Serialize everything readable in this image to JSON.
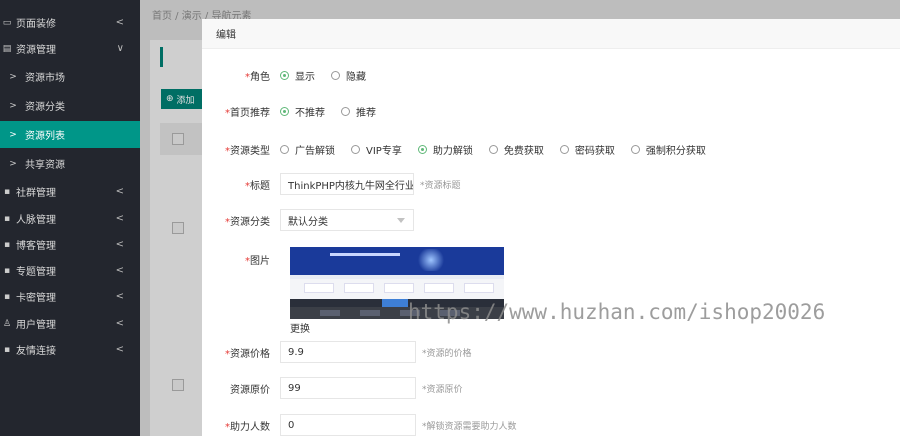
{
  "sidebar": {
    "items": [
      {
        "label": "页面装修",
        "icon": "desktop-icon",
        "type": "group",
        "expanded": false
      },
      {
        "label": "资源管理",
        "icon": "folder-icon",
        "type": "group",
        "expanded": true
      },
      {
        "label": "资源市场",
        "icon": "chevron-right-icon",
        "type": "sub"
      },
      {
        "label": "资源分类",
        "icon": "chevron-right-icon",
        "type": "sub"
      },
      {
        "label": "资源列表",
        "icon": "chevron-right-icon",
        "type": "sub",
        "active": true
      },
      {
        "label": "共享资源",
        "icon": "chevron-right-icon",
        "type": "sub"
      },
      {
        "label": "社群管理",
        "icon": "group-icon",
        "type": "group",
        "expanded": false
      },
      {
        "label": "人脉管理",
        "icon": "contacts-icon",
        "type": "group",
        "expanded": false
      },
      {
        "label": "博客管理",
        "icon": "blog-icon",
        "type": "group",
        "expanded": false
      },
      {
        "label": "专题管理",
        "icon": "topic-icon",
        "type": "group",
        "expanded": false
      },
      {
        "label": "卡密管理",
        "icon": "card-icon",
        "type": "group",
        "expanded": false
      },
      {
        "label": "用户管理",
        "icon": "user-icon",
        "type": "group",
        "expanded": false
      },
      {
        "label": "友情连接",
        "icon": "link-icon",
        "type": "group",
        "expanded": false
      }
    ],
    "active_color": "#009688"
  },
  "background": {
    "breadcrumb": "首页  /  演示  /  导航元素",
    "add_button": "添加"
  },
  "modal": {
    "title": "编辑",
    "role": {
      "label": "角色",
      "options": [
        "显示",
        "隐藏"
      ],
      "selected": "显示"
    },
    "homepage_recommend": {
      "label": "首页推荐",
      "options": [
        "不推荐",
        "推荐"
      ],
      "selected": "不推荐"
    },
    "resource_type": {
      "label": "资源类型",
      "options": [
        "广告解锁",
        "VIP专享",
        "助力解锁",
        "免费获取",
        "密码获取",
        "强制积分获取"
      ],
      "selected": "助力解锁"
    },
    "title_field": {
      "label": "标题",
      "value": "ThinkPHP内核九牛网全行业小程",
      "hint": "*资源标题"
    },
    "category": {
      "label": "资源分类",
      "value": "默认分类"
    },
    "image": {
      "label": "图片",
      "change_label": "更换"
    },
    "price": {
      "label": "资源价格",
      "value": "9.9",
      "hint": "*资源的价格"
    },
    "original_price": {
      "label": "资源原价",
      "value": "99",
      "hint": "*资源原价"
    },
    "helpers": {
      "label": "助力人数",
      "value": "0",
      "hint": "*解锁资源需要助力人数"
    },
    "accent_color": "#5fb878",
    "required_color": "#e53935"
  },
  "watermark": "https://www.huzhan.com/ishop20026"
}
